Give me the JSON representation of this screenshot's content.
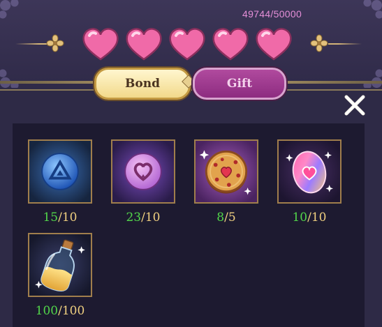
{
  "header": {
    "affection_progress": "49744/50000",
    "hearts_filled": 5
  },
  "tabs": [
    {
      "label": "Bond",
      "active": false
    },
    {
      "label": "Gift",
      "active": true
    }
  ],
  "items": [
    {
      "name": "blue-triangle-orb",
      "have": "15",
      "need": "10"
    },
    {
      "name": "heart-orb",
      "have": "23",
      "need": "10"
    },
    {
      "name": "heart-cookie",
      "have": "8",
      "need": "5"
    },
    {
      "name": "rainbow-heart-gem",
      "have": "10",
      "need": "10"
    },
    {
      "name": "golden-sand-bottle",
      "have": "100",
      "need": "100"
    }
  ],
  "colors": {
    "have_count": "#52d64a",
    "need_count": "#f0d080",
    "progress_text": "#e58fd8",
    "heart": "#f06aa8"
  },
  "icons": {
    "close": "close-x-icon",
    "ornament": "flower-ornament-icon"
  }
}
